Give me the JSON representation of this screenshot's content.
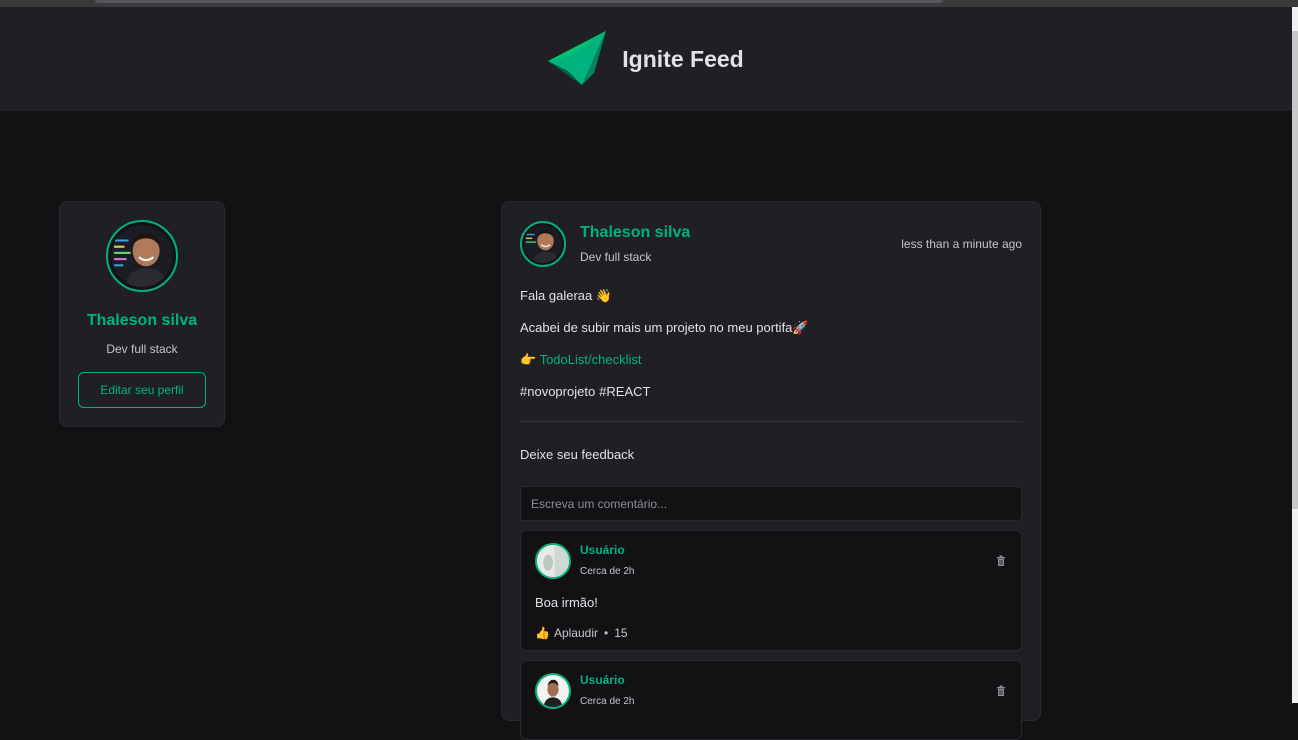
{
  "app": {
    "title": "Ignite Feed"
  },
  "profile": {
    "name": "Thaleson silva",
    "role": "Dev full stack",
    "edit_label": "Editar seu perfil"
  },
  "post": {
    "author_name": "Thaleson silva",
    "author_role": "Dev full stack",
    "time": "less than a minute ago",
    "greeting": "Fala galeraa",
    "greeting_emoji": "👋",
    "body": "Acabei de subir mais um projeto no meu portifa",
    "body_emoji": "🚀",
    "link_emoji": "👉",
    "link_text": "TodoList/checklist",
    "hashtags": [
      "#novoprojeto",
      "#REACT"
    ]
  },
  "feedback": {
    "label": "Deixe seu feedback",
    "placeholder": "Escreva um comentário..."
  },
  "comments": [
    {
      "author": "Usuário",
      "time": "Cerca de 2h",
      "text": "Boa irmão!",
      "applaud_icon": "👍",
      "applaud_label": "Aplaudir",
      "separator": "•",
      "applaud_count": "15"
    },
    {
      "author": "Usuário",
      "time": "Cerca de 2h"
    }
  ],
  "colors": {
    "accent": "#00b37e",
    "background": "#121214",
    "surface": "#202024"
  }
}
